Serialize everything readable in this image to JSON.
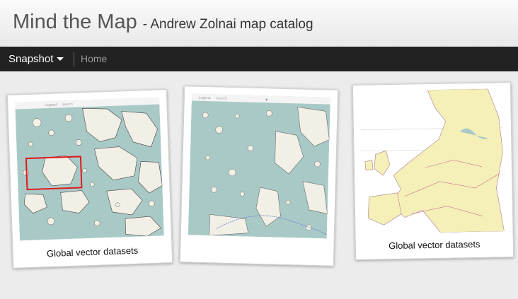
{
  "header": {
    "title": "Mind the Map",
    "subtitle": "- Andrew Zolnai map catalog"
  },
  "navbar": {
    "snapshot_label": "Snapshot",
    "home_label": "Home"
  },
  "gallery": [
    {
      "caption": "Global vector datasets",
      "toolbar_legend": "Legend",
      "toolbar_search": "Search"
    },
    {
      "caption": "",
      "toolbar_legend": "Legend",
      "toolbar_search": "Search"
    },
    {
      "caption": "Global vector datasets"
    }
  ],
  "colors": {
    "sea": "#a9c9c7",
    "land": "#f1efe6",
    "europe_land": "#f5efb8",
    "highlight": "#e0191b",
    "navbar": "#222222"
  }
}
